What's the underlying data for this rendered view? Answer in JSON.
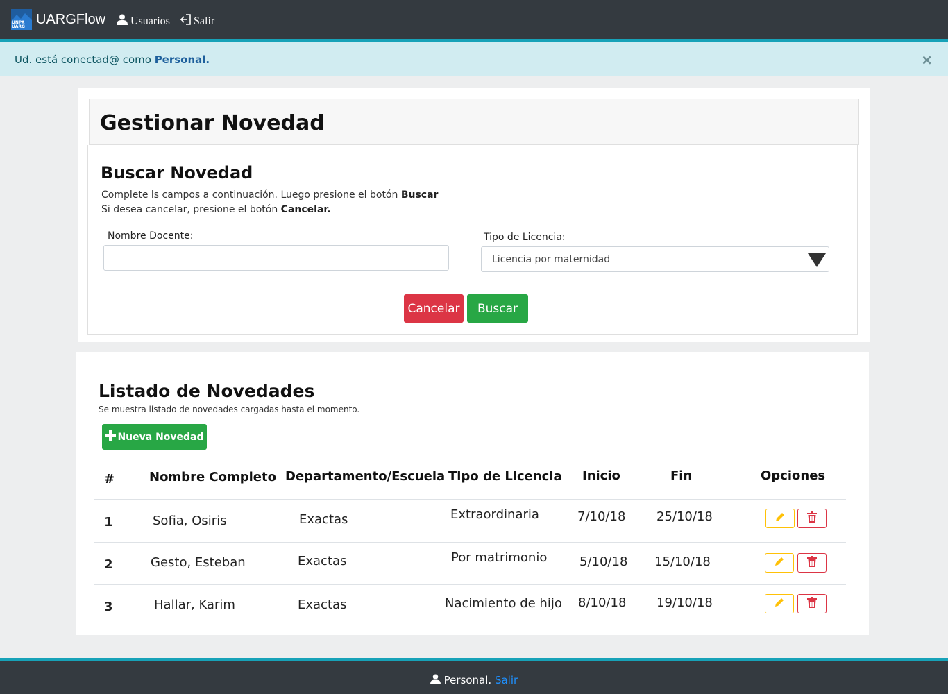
{
  "navbar": {
    "logo_text": "UNPA UARG",
    "brand": "UARGFlow",
    "links": [
      {
        "label": "Usuarios",
        "icon": "user-icon"
      },
      {
        "label": "Salir",
        "icon": "sign-out-icon"
      }
    ]
  },
  "alert": {
    "prefix": "Ud. está conectad@ como ",
    "role": "Personal.",
    "close": "×"
  },
  "search_card": {
    "title": "Gestionar Novedad",
    "section_title": "Buscar  Novedad",
    "instr1_text": "Complete ls campos a continuación. Luego presione el botón ",
    "instr1_bold": "Buscar",
    "instr2_text": "Si desea cancelar, presione el botón ",
    "instr2_bold": "Cancelar.",
    "docente_label": "Nombre Docente:",
    "docente_value": "",
    "licencia_label": "Tipo de Licencia:",
    "licencia_value": "Licencia por maternidad",
    "cancel_label": "Cancelar",
    "search_label": "Buscar"
  },
  "list_card": {
    "title_light": "Listado de ",
    "title_bold": "Novedades",
    "subtitle": "Se muestra listado de novedades cargadas hasta el momento.",
    "new_button": "Nueva Novedad",
    "headers": {
      "num": "#",
      "nombre": "Nombre Completo",
      "depto": "Departamento/Escuela",
      "tipo": "Tipo de Licencia",
      "inicio": "Inicio",
      "fin": "Fin",
      "opciones": "Opciones"
    },
    "rows": [
      {
        "num": "1",
        "nombre": "Sofia, Osiris",
        "depto": "Exactas",
        "tipo": "Extraordinaria",
        "inicio": "7/10/18",
        "fin": "25/10/18"
      },
      {
        "num": "2",
        "nombre": "Gesto, Esteban",
        "depto": "Exactas",
        "tipo": "Por matrimonio",
        "inicio": "5/10/18",
        "fin": "15/10/18"
      },
      {
        "num": "3",
        "nombre": "Hallar, Karim",
        "depto": "Exactas",
        "tipo": "Nacimiento de hijo",
        "inicio": "8/10/18",
        "fin": "19/10/18"
      }
    ]
  },
  "footer": {
    "user": "Personal.",
    "logout": "Salir"
  },
  "colors": {
    "navbar": "#343a40",
    "accent": "#17a2b8",
    "success": "#28a745",
    "danger": "#dc3545",
    "warning": "#ffc107",
    "alert_bg": "#d1ecf1"
  }
}
